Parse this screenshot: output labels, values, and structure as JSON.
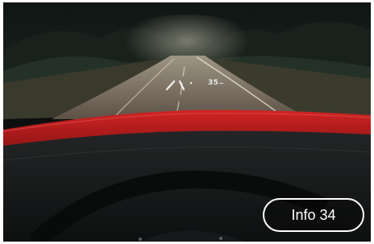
{
  "hud": {
    "speed": "35",
    "icon": "navigation-arrows-icon"
  },
  "controls": {
    "info_label": "Info 34"
  },
  "colors": {
    "hood": "#c01f1f",
    "button_border": "#ffffff",
    "sky": "#0b1210"
  }
}
